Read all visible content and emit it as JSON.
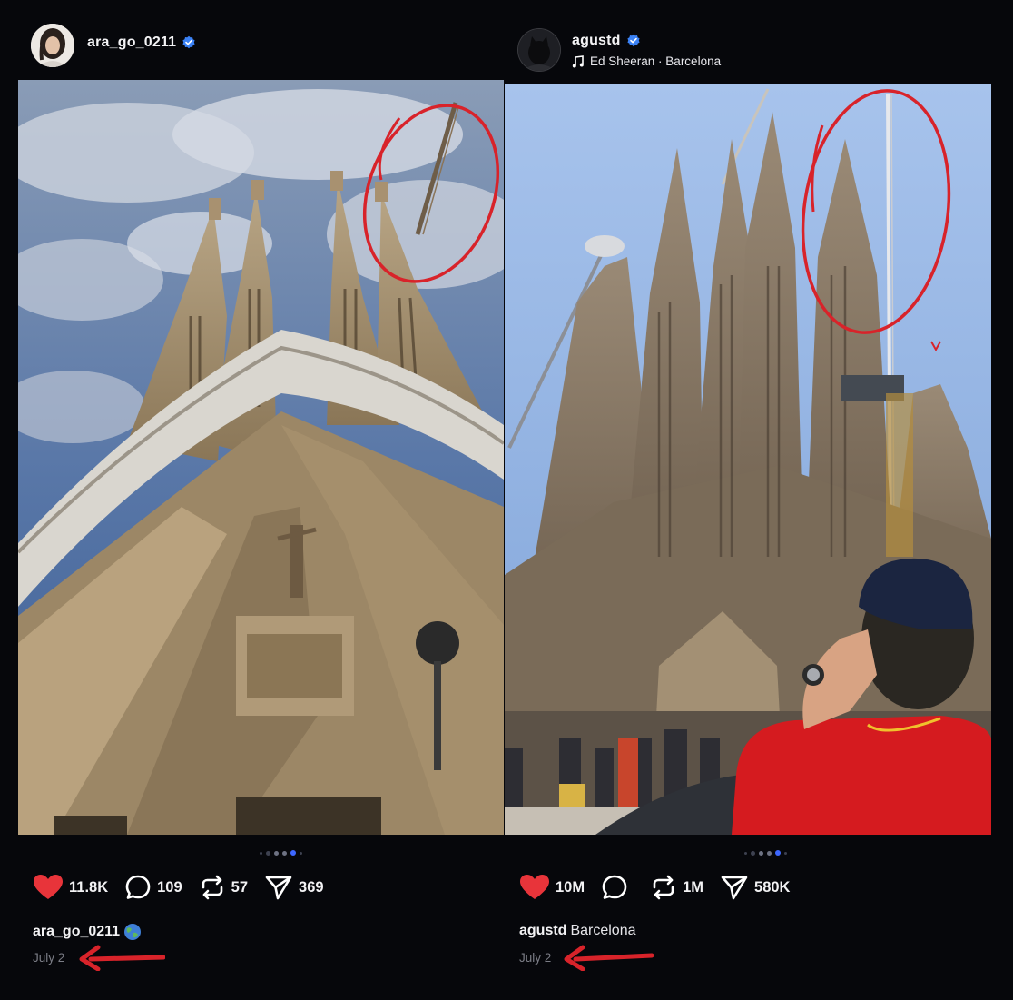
{
  "posts": [
    {
      "username": "ara_go_0211",
      "likes": "11.8K",
      "comments": "109",
      "reposts": "57",
      "shares": "369",
      "caption_user": "ara_go_0211",
      "date": "July 2"
    },
    {
      "username": "agustd",
      "music": "Ed Sheeran · Barcelona",
      "likes": "10M",
      "comments": "",
      "reposts": "1M",
      "shares": "580K",
      "caption_user": "agustd",
      "caption_location": "Barcelona",
      "date": "July 2"
    }
  ],
  "colors": {
    "background": "#06070b",
    "verified": "#3b82f6",
    "like_heart": "#e8343a",
    "annotation_red": "#d8232a",
    "active_dot": "#3d67ff"
  },
  "icons": [
    "verified-icon",
    "heart-icon",
    "comment-icon",
    "repost-icon",
    "share-icon",
    "music-note-icon",
    "globe-icon"
  ]
}
